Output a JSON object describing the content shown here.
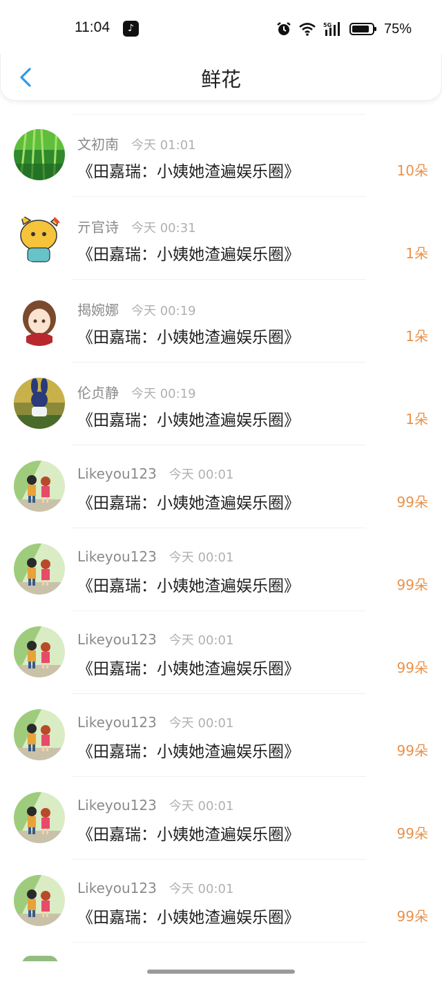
{
  "status": {
    "time": "11:04",
    "battery": "75%",
    "network": "5G",
    "icons": [
      "tiktok-icon",
      "alarm-icon",
      "wifi-icon",
      "signal-icon",
      "battery-icon"
    ]
  },
  "nav": {
    "title": "鲜花",
    "back_icon": "chevron-left-icon"
  },
  "colors": {
    "accent": "#2b9ae8",
    "count": "#e8924c",
    "name": "#8a8a8a",
    "time": "#b0b0b0"
  },
  "rows": [
    {
      "name": "文初南",
      "time": "今天 01:01",
      "book": "《田嘉瑞：小姨她渣遍娱乐圈》",
      "count": "10朵",
      "avatar": "bamboo-avatar"
    },
    {
      "name": "亓官诗",
      "time": "今天 00:31",
      "book": "《田嘉瑞：小姨她渣遍娱乐圈》",
      "count": "1朵",
      "avatar": "cartoon-fox-avatar"
    },
    {
      "name": "揭婉娜",
      "time": "今天 00:19",
      "book": "《田嘉瑞：小姨她渣遍娱乐圈》",
      "count": "1朵",
      "avatar": "anime-girl-avatar"
    },
    {
      "name": "伦贞静",
      "time": "今天 00:19",
      "book": "《田嘉瑞：小姨她渣遍娱乐圈》",
      "count": "1朵",
      "avatar": "bunny-toy-avatar"
    },
    {
      "name": "Likeyou123",
      "time": "今天 00:01",
      "book": "《田嘉瑞：小姨她渣遍娱乐圈》",
      "count": "99朵",
      "avatar": "anime-kids-avatar"
    },
    {
      "name": "Likeyou123",
      "time": "今天 00:01",
      "book": "《田嘉瑞：小姨她渣遍娱乐圈》",
      "count": "99朵",
      "avatar": "anime-kids-avatar"
    },
    {
      "name": "Likeyou123",
      "time": "今天 00:01",
      "book": "《田嘉瑞：小姨她渣遍娱乐圈》",
      "count": "99朵",
      "avatar": "anime-kids-avatar"
    },
    {
      "name": "Likeyou123",
      "time": "今天 00:01",
      "book": "《田嘉瑞：小姨她渣遍娱乐圈》",
      "count": "99朵",
      "avatar": "anime-kids-avatar"
    },
    {
      "name": "Likeyou123",
      "time": "今天 00:01",
      "book": "《田嘉瑞：小姨她渣遍娱乐圈》",
      "count": "99朵",
      "avatar": "anime-kids-avatar"
    },
    {
      "name": "Likeyou123",
      "time": "今天 00:01",
      "book": "《田嘉瑞：小姨她渣遍娱乐圈》",
      "count": "99朵",
      "avatar": "anime-kids-avatar"
    }
  ]
}
